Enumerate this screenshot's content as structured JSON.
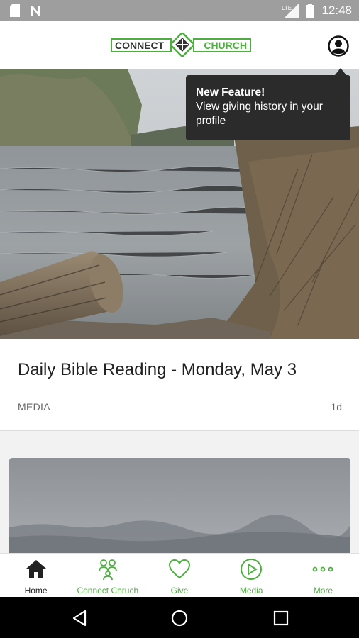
{
  "status_bar": {
    "time": "12:48",
    "network_label": "LTE",
    "left_icons": [
      "sd-card-icon",
      "n-notification-icon"
    ],
    "right_icons": [
      "lte-signal-icon",
      "battery-icon"
    ]
  },
  "header": {
    "logo_left": "CONNECT",
    "logo_right": "CHURCH",
    "brand_color": "#4caf3e",
    "profile_icon": "profile-icon"
  },
  "tooltip": {
    "title": "New Feature!",
    "body": "View giving history in your profile"
  },
  "feed": {
    "items": [
      {
        "title": "Daily Bible Reading - Monday, May 3",
        "category": "MEDIA",
        "age": "1d",
        "image": "lake-with-log-photo"
      },
      {
        "image": "foggy-mountains-photo"
      }
    ]
  },
  "bottom_nav": {
    "items": [
      {
        "label": "Home",
        "icon": "home-icon",
        "active": true
      },
      {
        "label": "Connect Chruch",
        "icon": "people-icon",
        "active": false
      },
      {
        "label": "Give",
        "icon": "heart-icon",
        "active": false
      },
      {
        "label": "Media",
        "icon": "play-circle-icon",
        "active": false
      },
      {
        "label": "More",
        "icon": "more-dots-icon",
        "active": false
      }
    ],
    "active_color": "#222222",
    "inactive_color": "#4caf3e"
  },
  "android_nav": {
    "icons": [
      "back-icon",
      "home-circle-icon",
      "recents-icon"
    ]
  }
}
